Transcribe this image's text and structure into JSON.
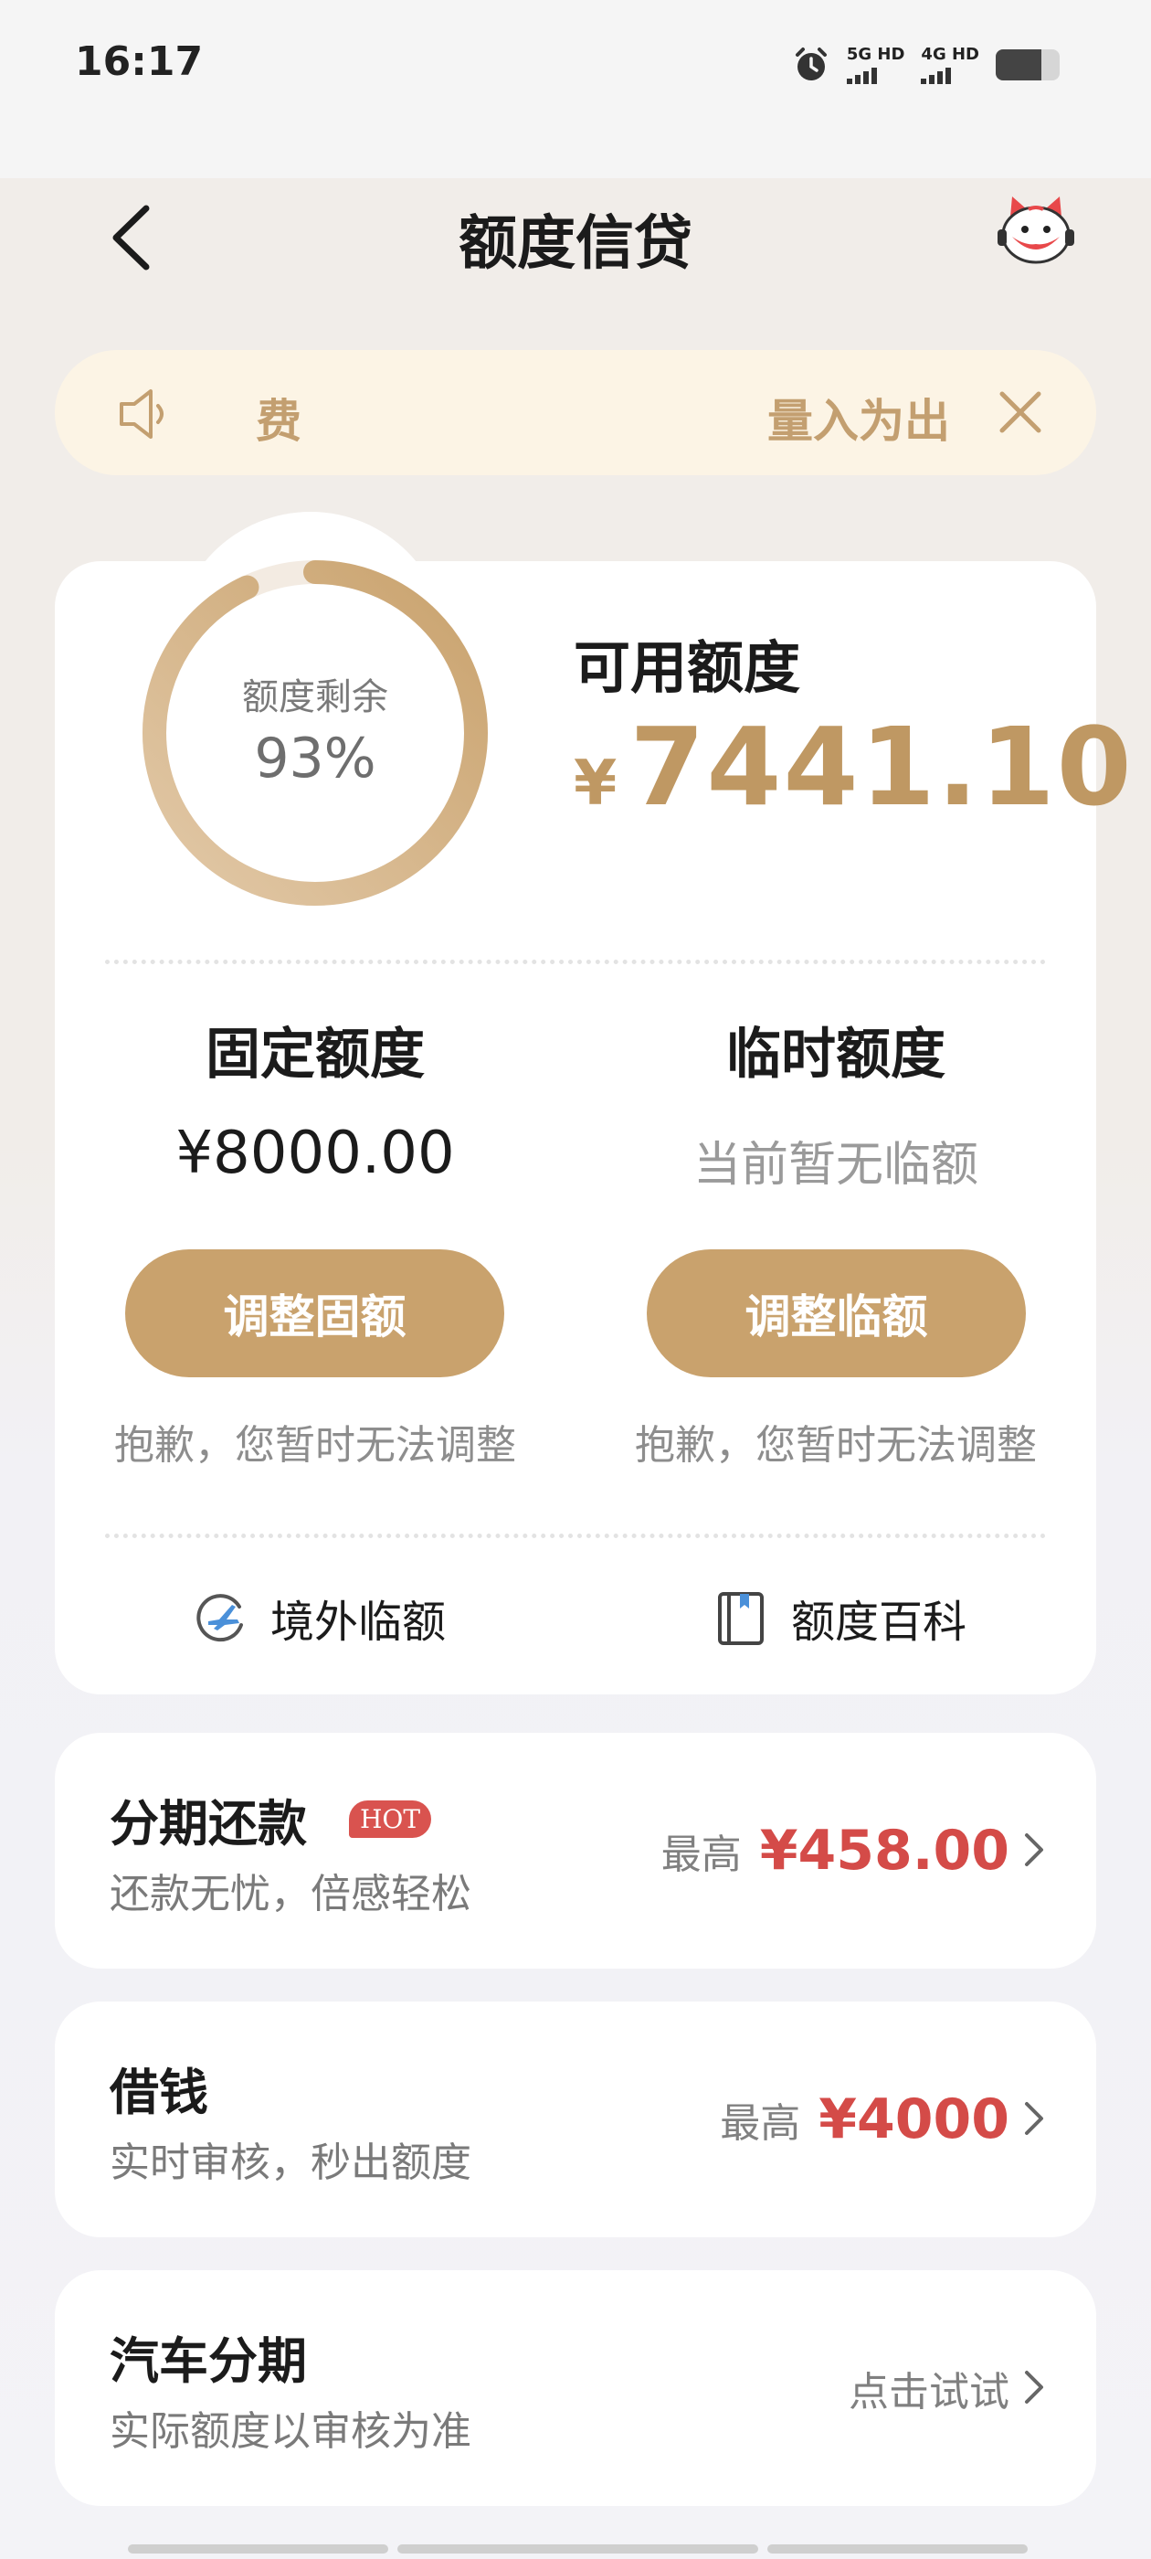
{
  "status_bar": {
    "time": "16:17",
    "signal_1": "5G HD",
    "signal_2": "4G HD"
  },
  "header": {
    "title": "额度信贷"
  },
  "notice": {
    "fee_text": "费",
    "tip_text": "量入为出"
  },
  "credit": {
    "ring_label": "额度剩余",
    "ring_percent": "93%",
    "remaining_fraction": 0.93,
    "available_label": "可用额度",
    "currency_symbol": "¥",
    "available_amount": "7441.10"
  },
  "fixed": {
    "title": "固定额度",
    "value": "¥8000.00",
    "button": "调整固额",
    "note": "抱歉，您暂时无法调整"
  },
  "temp": {
    "title": "临时额度",
    "value": "当前暂无临额",
    "button": "调整临额",
    "note": "抱歉，您暂时无法调整"
  },
  "links": {
    "overseas": "境外临额",
    "wiki": "额度百科"
  },
  "services": [
    {
      "title": "分期还款",
      "badge": "HOT",
      "subtitle": "还款无忧，倍感轻松",
      "prefix": "最高",
      "amount": "¥458.00"
    },
    {
      "title": "借钱",
      "subtitle": "实时审核，秒出额度",
      "prefix": "最高",
      "amount": "¥4000"
    },
    {
      "title": "汽车分期",
      "subtitle": "实际额度以审核为准",
      "action": "点击试试"
    }
  ],
  "colors": {
    "gold": "#c9a26d",
    "gold_text": "#bf9863",
    "red": "#d44b48",
    "notice_bg": "#fcf4e5"
  },
  "icons": [
    "back-icon",
    "mascot-icon",
    "speaker-icon",
    "close-icon",
    "plane-icon",
    "book-icon",
    "chevron-right-icon",
    "alarm-icon",
    "battery-icon"
  ]
}
